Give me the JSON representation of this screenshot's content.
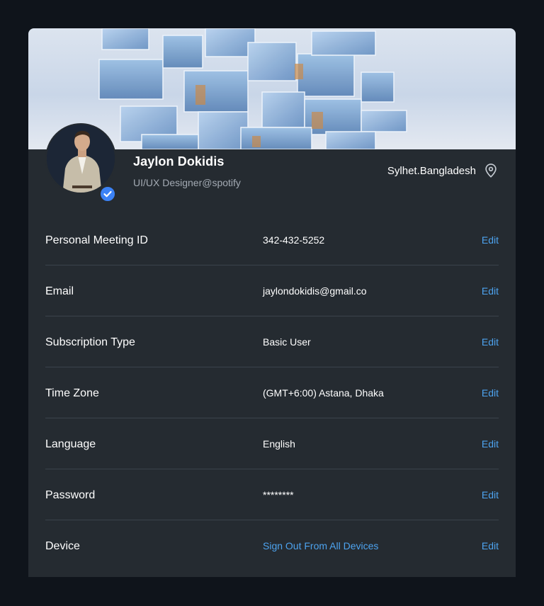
{
  "profile": {
    "name": "Jaylon Dokidis",
    "role": "UI/UX Designer@spotify",
    "location": "Sylhet.Bangladesh",
    "verified": true
  },
  "rows": [
    {
      "label": "Personal Meeting ID",
      "value": "342-432-5252",
      "action": "Edit",
      "value_is_link": false
    },
    {
      "label": "Email",
      "value": "jaylondokidis@gmail.co",
      "action": "Edit",
      "value_is_link": false
    },
    {
      "label": "Subscription Type",
      "value": "Basic User",
      "action": "Edit",
      "value_is_link": false
    },
    {
      "label": "Time Zone",
      "value": "(GMT+6:00) Astana, Dhaka",
      "action": "Edit",
      "value_is_link": false
    },
    {
      "label": "Language",
      "value": "English",
      "action": "Edit",
      "value_is_link": false
    },
    {
      "label": "Password",
      "value": "********",
      "action": "Edit",
      "value_is_link": false
    },
    {
      "label": "Device",
      "value": "Sign Out From All Devices",
      "action": "Edit",
      "value_is_link": true
    }
  ],
  "colors": {
    "page_bg": "#0f141b",
    "card_bg": "#252b31",
    "accent_link": "#4da3ef",
    "verified_badge": "#3b82f6",
    "muted_text": "#a3aab3",
    "divider": "#3b434c"
  },
  "icons": {
    "location": "map-pin-icon",
    "verified": "check-badge-icon"
  }
}
